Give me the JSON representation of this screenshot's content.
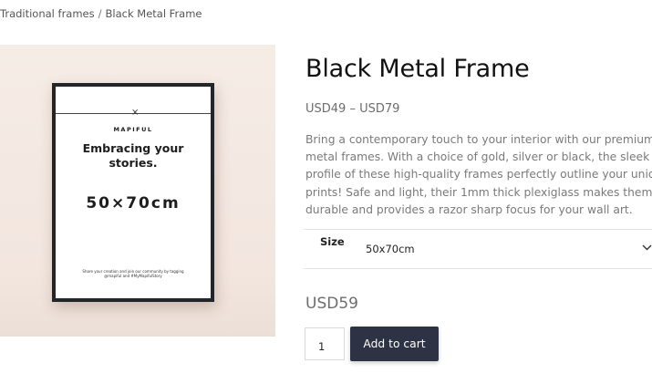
{
  "breadcrumb": {
    "items": [
      "Traditional frames",
      "Black Metal Frame"
    ],
    "separator": "/"
  },
  "product": {
    "title": "Black Metal Frame",
    "price_range": "USD49 – USD79",
    "description_lines": [
      "Bring a contemporary touch to your interior with our premium",
      "metal frames. With a choice of gold, silver or black, the sleek",
      "profile of these high-quality frames perfectly outline your unique",
      "prints! Safe and light, their 1mm thick plexiglass makes them supe",
      "durable and provides a razor sharp focus for your wall art."
    ],
    "image": {
      "brand": "MAPIFUL",
      "tagline_line1": "Embracing your",
      "tagline_line2": "stories.",
      "size_text": "50×70cm",
      "small_print": "Share your creation and join our community by tagging @mapiful and #MyMapifulStory"
    }
  },
  "variation": {
    "label": "Size",
    "selected": "50x70cm",
    "dropdown_icon": "chevron-down-icon"
  },
  "price": {
    "current": "USD59"
  },
  "cart": {
    "quantity": "1",
    "button_label": "Add to cart",
    "button_color": "#2d3345"
  }
}
